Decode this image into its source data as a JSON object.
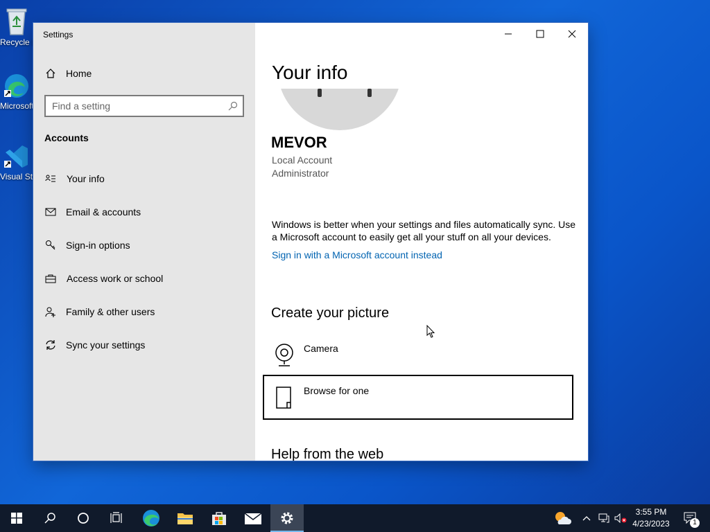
{
  "desktop": {
    "icons": [
      {
        "label": "Recycle Bin",
        "icon": "recycle-bin-icon"
      },
      {
        "label": "Microsoft Edge",
        "icon": "edge-icon"
      },
      {
        "label": "Visual Studio Code",
        "icon": "vscode-icon"
      }
    ]
  },
  "window": {
    "title": "Settings",
    "controls": {
      "minimize": "minimize-icon",
      "maximize": "maximize-icon",
      "close": "close-icon"
    }
  },
  "sidebar": {
    "home_label": "Home",
    "search_placeholder": "Find a setting",
    "section_title": "Accounts",
    "items": [
      {
        "label": "Your info",
        "icon": "person-card-icon"
      },
      {
        "label": "Email & accounts",
        "icon": "mail-icon"
      },
      {
        "label": "Sign-in options",
        "icon": "key-icon"
      },
      {
        "label": "Access work or school",
        "icon": "briefcase-icon"
      },
      {
        "label": "Family & other users",
        "icon": "add-person-icon"
      },
      {
        "label": "Sync your settings",
        "icon": "sync-icon"
      }
    ]
  },
  "content": {
    "title": "Your info",
    "user": {
      "name": "MEVOR",
      "account_type": "Local Account",
      "role": "Administrator"
    },
    "sync_text": "Windows is better when your settings and files automatically sync. Use a Microsoft account to easily get all your stuff on all your devices.",
    "sign_in_link": "Sign in with a Microsoft account instead",
    "create_picture_heading": "Create your picture",
    "picture_options": [
      {
        "label": "Camera",
        "icon": "camera-icon"
      },
      {
        "label": "Browse for one",
        "icon": "file-icon"
      }
    ],
    "help_heading": "Help from the web"
  },
  "taskbar": {
    "buttons": [
      "start-icon",
      "search-icon",
      "cortana-icon",
      "task-view-icon",
      "edge-icon",
      "file-explorer-icon",
      "store-icon",
      "mail-icon",
      "settings-icon"
    ],
    "clock_time": "3:55 PM",
    "clock_date": "4/23/2023",
    "notification_count": "1"
  },
  "colors": {
    "accent_link": "#0063b1",
    "sidebar_bg": "#e6e6e6",
    "taskbar_bg": "#101a2b"
  }
}
